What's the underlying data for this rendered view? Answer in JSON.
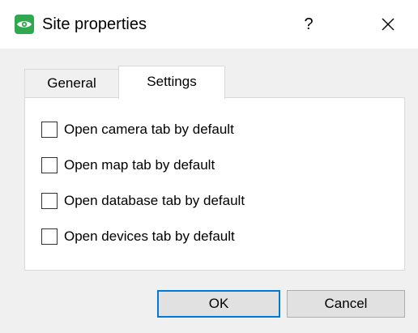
{
  "window": {
    "title": "Site properties",
    "app_icon": "eye-icon",
    "help_label": "?",
    "close_icon": "close-icon"
  },
  "tabs": [
    {
      "label": "General",
      "selected": false
    },
    {
      "label": "Settings",
      "selected": true
    }
  ],
  "settings": {
    "options": [
      {
        "label": "Open camera tab by default",
        "checked": false
      },
      {
        "label": "Open map tab by default",
        "checked": false
      },
      {
        "label": "Open database tab by default",
        "checked": false
      },
      {
        "label": "Open devices tab by default",
        "checked": false
      }
    ]
  },
  "buttons": {
    "ok_label": "OK",
    "cancel_label": "Cancel"
  },
  "colors": {
    "accent": "#0078d7",
    "app_icon": "#2fa84f"
  }
}
